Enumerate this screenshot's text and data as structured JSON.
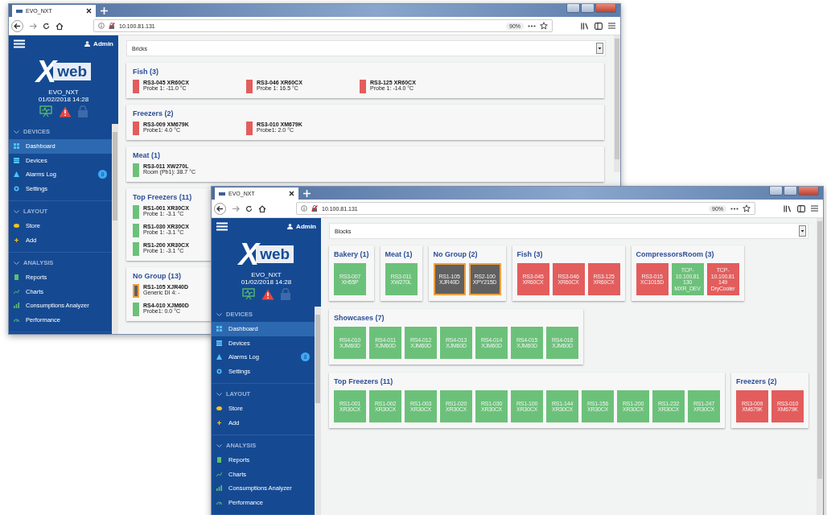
{
  "windows": [
    {
      "kind": "bricks",
      "tab_title": "EVO_NXT",
      "url": "10.100.81.131",
      "zoom": "90%",
      "user": "Admin",
      "logo_mark": "X",
      "logo_word": "web",
      "site": "EVO_NXT",
      "datetime": "01/02/2018 14:28",
      "nav": [
        {
          "title": "DEVICES",
          "items": [
            {
              "label": "Dashboard",
              "selected": true
            },
            {
              "label": "Devices",
              "selected": false
            },
            {
              "label": "Alarms Log",
              "selected": false,
              "badge": "8"
            },
            {
              "label": "Settings",
              "selected": false
            }
          ]
        },
        {
          "title": "LAYOUT",
          "items": [
            {
              "label": "Store",
              "selected": false
            },
            {
              "label": "Add",
              "selected": false
            }
          ]
        },
        {
          "title": "ANALYSIS",
          "items": [
            {
              "label": "Reports",
              "selected": false
            },
            {
              "label": "Charts",
              "selected": false
            },
            {
              "label": "Consumptions Analyzer",
              "selected": false
            },
            {
              "label": "Performance",
              "selected": false
            }
          ]
        }
      ],
      "view_select": "Bricks",
      "groups": [
        {
          "title": "Fish (3)",
          "kind": "inline",
          "devices": [
            {
              "name": "RS3-045 XR60CX",
              "reading": "Probe 1: -11.0 °C",
              "color": "#e35d5d",
              "kind": "online"
            },
            {
              "name": "RS3-046 XR60CX",
              "reading": "Probe 1: 16.5 °C",
              "color": "#e35d5d",
              "kind": "online"
            },
            {
              "name": "RS3-125 XR60CX",
              "reading": "Probe 1: -14.0 °C",
              "color": "#e35d5d",
              "kind": "online"
            }
          ]
        },
        {
          "title": "Freezers (2)",
          "kind": "inline",
          "devices": [
            {
              "name": "RS3-009 XM679K",
              "reading": "Probe1: 4.0 °C",
              "color": "#e35d5d",
              "kind": "online"
            },
            {
              "name": "RS3-010 XM679K",
              "reading": "Probe1: 2.0 °C",
              "color": "#e35d5d",
              "kind": "online"
            }
          ]
        },
        {
          "title": "Meat (1)",
          "kind": "inline",
          "devices": [
            {
              "name": "RS3-011 XW270L",
              "reading": "Room (Pb1): 38.7 °C",
              "color": "#6cc17a",
              "kind": "online"
            }
          ]
        },
        {
          "title": "Top Freezers (11)",
          "kind": "stacked",
          "devices": [
            {
              "name": "RS1-001 XR30CX",
              "reading": "Probe 1: -3.1 °C",
              "color": "#6cc17a",
              "kind": "online"
            },
            {
              "name": "RS1-030 XR30CX",
              "reading": "Probe 1: -3.1 °C",
              "color": "#6cc17a",
              "kind": "online"
            },
            {
              "name": "RS1-200 XR30CX",
              "reading": "Probe 1: -3.1 °C",
              "color": "#6cc17a",
              "kind": "online"
            }
          ]
        },
        {
          "title": "No Group (13)",
          "kind": "stacked",
          "devices": [
            {
              "name": "RS1-105 XJR40D",
              "reading": "Generic DI 4: -",
              "color": "#606060",
              "kind": "offline"
            },
            {
              "name": "RS4-010 XJM60D",
              "reading": "Probe1: 0.0 °C",
              "color": "#6cc17a",
              "kind": "online"
            }
          ]
        }
      ]
    },
    {
      "kind": "blocks",
      "tab_title": "EVO_NXT",
      "url": "10.100.81.131",
      "zoom": "90%",
      "user": "Admin",
      "logo_mark": "X",
      "logo_word": "web",
      "site": "EVO_NXT",
      "datetime": "01/02/2018 14:28",
      "nav": [
        {
          "title": "DEVICES",
          "items": [
            {
              "label": "Dashboard",
              "selected": true
            },
            {
              "label": "Devices",
              "selected": false
            },
            {
              "label": "Alarms Log",
              "selected": false,
              "badge": "8"
            },
            {
              "label": "Settings",
              "selected": false
            }
          ]
        },
        {
          "title": "LAYOUT",
          "items": [
            {
              "label": "Store",
              "selected": false
            },
            {
              "label": "Add",
              "selected": false
            }
          ]
        },
        {
          "title": "ANALYSIS",
          "items": [
            {
              "label": "Reports",
              "selected": false
            },
            {
              "label": "Charts",
              "selected": false
            },
            {
              "label": "Consumptions Analyzer",
              "selected": false
            },
            {
              "label": "Performance",
              "selected": false
            }
          ]
        }
      ],
      "view_select": "Blocks",
      "groups": [
        {
          "title": "Bakery (1)",
          "devices": [
            {
              "lines": [
                "RS3-007",
                "XH55P"
              ],
              "color": "#6cc17a",
              "kind": "online"
            }
          ]
        },
        {
          "title": "Meat (1)",
          "devices": [
            {
              "lines": [
                "RS3-011",
                "XW270L"
              ],
              "color": "#6cc17a",
              "kind": "online"
            }
          ]
        },
        {
          "title": "No Group (2)",
          "devices": [
            {
              "lines": [
                "RS1-105",
                "XJR40D"
              ],
              "color": "#606060",
              "kind": "offline"
            },
            {
              "lines": [
                "RS2-100",
                "XPY215D"
              ],
              "color": "#606060",
              "kind": "offline"
            }
          ]
        },
        {
          "title": "Fish (3)",
          "devices": [
            {
              "lines": [
                "RS3-045",
                "XR60CX"
              ],
              "color": "#e35d5d",
              "kind": "online"
            },
            {
              "lines": [
                "RS3-046",
                "XR60CX"
              ],
              "color": "#e35d5d",
              "kind": "online"
            },
            {
              "lines": [
                "RS3-125",
                "XR60CX"
              ],
              "color": "#e35d5d",
              "kind": "online"
            }
          ]
        },
        {
          "title": "CompressorsRoom (3)",
          "devices": [
            {
              "lines": [
                "RS3-015",
                "XC1015D"
              ],
              "color": "#e35d5d",
              "kind": "online"
            },
            {
              "lines": [
                "TCP-10.100.81",
                "130",
                "MXR_DEV"
              ],
              "color": "#6cc17a",
              "kind": "online"
            },
            {
              "lines": [
                "TCP-10.100.81",
                "149",
                "DryCooler"
              ],
              "color": "#e35d5d",
              "kind": "online"
            }
          ]
        },
        {
          "title": "Showcases (7)",
          "devices": [
            {
              "lines": [
                "RS4-010",
                "XJM60D"
              ],
              "color": "#6cc17a",
              "kind": "online"
            },
            {
              "lines": [
                "RS4-011",
                "XJM60D"
              ],
              "color": "#6cc17a",
              "kind": "online"
            },
            {
              "lines": [
                "RS4-012",
                "XJM60D"
              ],
              "color": "#6cc17a",
              "kind": "online"
            },
            {
              "lines": [
                "RS4-013",
                "XJM60D"
              ],
              "color": "#6cc17a",
              "kind": "online"
            },
            {
              "lines": [
                "RS4-014",
                "XJM60D"
              ],
              "color": "#6cc17a",
              "kind": "online"
            },
            {
              "lines": [
                "RS4-015",
                "XJM60D"
              ],
              "color": "#6cc17a",
              "kind": "online"
            },
            {
              "lines": [
                "RS4-016",
                "XJM60D"
              ],
              "color": "#6cc17a",
              "kind": "online"
            }
          ]
        },
        {
          "title": "Top Freezers (11)",
          "devices": [
            {
              "lines": [
                "RS1-001",
                "XR30CX"
              ],
              "color": "#6cc17a",
              "kind": "online"
            },
            {
              "lines": [
                "RS1-002",
                "XR30CX"
              ],
              "color": "#6cc17a",
              "kind": "online"
            },
            {
              "lines": [
                "RS1-003",
                "XR30CX"
              ],
              "color": "#6cc17a",
              "kind": "online"
            },
            {
              "lines": [
                "RS1-020",
                "XR30CX"
              ],
              "color": "#6cc17a",
              "kind": "online"
            },
            {
              "lines": [
                "RS1-030",
                "XR30CX"
              ],
              "color": "#6cc17a",
              "kind": "online"
            },
            {
              "lines": [
                "RS1-100",
                "XR30CX"
              ],
              "color": "#6cc17a",
              "kind": "online"
            },
            {
              "lines": [
                "RS1-144",
                "XR30CX"
              ],
              "color": "#6cc17a",
              "kind": "online"
            },
            {
              "lines": [
                "RS1-156",
                "XR30CX"
              ],
              "color": "#6cc17a",
              "kind": "online"
            },
            {
              "lines": [
                "RS1-200",
                "XR30CX"
              ],
              "color": "#6cc17a",
              "kind": "online"
            },
            {
              "lines": [
                "RS1-232",
                "XR30CX"
              ],
              "color": "#6cc17a",
              "kind": "online"
            },
            {
              "lines": [
                "RS1-247",
                "XR30CX"
              ],
              "color": "#6cc17a",
              "kind": "online"
            }
          ]
        },
        {
          "title": "Freezers (2)",
          "devices": [
            {
              "lines": [
                "RS3-009",
                "XM679K"
              ],
              "color": "#e35d5d",
              "kind": "online"
            },
            {
              "lines": [
                "RS3-010",
                "XM679K"
              ],
              "color": "#e35d5d",
              "kind": "online"
            }
          ]
        }
      ]
    }
  ]
}
